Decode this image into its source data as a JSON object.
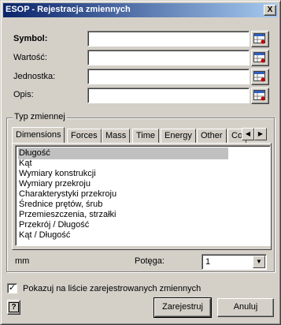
{
  "window": {
    "title": "ESOP - Rejestracja zmiennych",
    "close_label": "X"
  },
  "fields": [
    {
      "label": "Symbol:",
      "value": ""
    },
    {
      "label": "Wartość:",
      "value": ""
    },
    {
      "label": "Jednostka:",
      "value": ""
    },
    {
      "label": "Opis:",
      "value": ""
    }
  ],
  "group": {
    "title": "Typ zmiennej",
    "tabs": [
      "Dimensions",
      "Forces",
      "Mass",
      "Time",
      "Energy",
      "Other",
      "Co"
    ],
    "active_tab": "Dimensions",
    "list": [
      "Długość",
      "Kąt",
      "Wymiary konstrukcji",
      "Wymiary przekroju",
      "Charakterystyki przekroju",
      "Średnice prętów, śrub",
      "Przemieszczenia, strzałki",
      "Przekrój / Długość",
      "Kąt / Długość"
    ],
    "selected_item": "Długość",
    "unit": "mm",
    "power_label": "Potęga:",
    "power_value": "1"
  },
  "checkbox": {
    "label": "Pokazuj na liście zarejestrowanych zmiennych",
    "checked": true,
    "mark": "✓"
  },
  "buttons": {
    "register": "Zarejestruj",
    "cancel": "Anuluj",
    "help": "?"
  },
  "colors": {
    "face": "#d4d0c8",
    "titlebar_start": "#0a246a",
    "titlebar_end": "#a6caf0",
    "selection": "#c0c0c0"
  }
}
